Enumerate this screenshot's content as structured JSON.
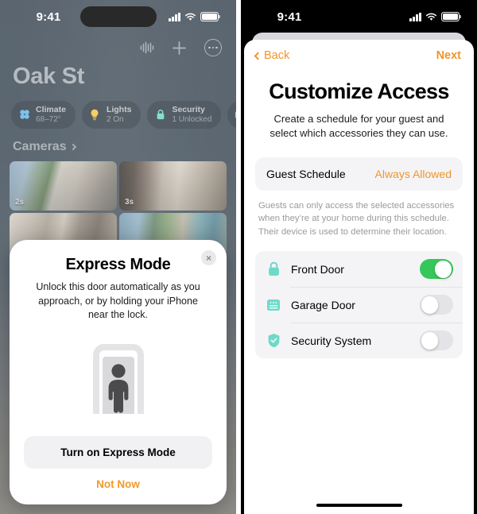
{
  "left_phone": {
    "status_bar": {
      "time": "9:41",
      "icons": [
        "cellular-signal-icon",
        "wifi-icon",
        "battery-icon"
      ]
    },
    "toolbar": {
      "items": [
        {
          "name": "siri-waveform-icon",
          "label": ""
        },
        {
          "name": "add-icon",
          "label": "+"
        },
        {
          "name": "more-icon",
          "label": ""
        }
      ]
    },
    "home_title": "Oak St",
    "chips": [
      {
        "icon": "climate-fan-icon",
        "title": "Climate",
        "subtitle": "68–72°"
      },
      {
        "icon": "lightbulb-icon",
        "title": "Lights",
        "subtitle": "2 On"
      },
      {
        "icon": "lock-icon",
        "title": "Security",
        "subtitle": "1 Unlocked"
      },
      {
        "icon": "speaker-icon",
        "title": "",
        "subtitle": ""
      }
    ],
    "cameras_header": "Cameras",
    "cameras": [
      {
        "badge": "2s"
      },
      {
        "badge": "3s"
      },
      {
        "badge": ""
      },
      {
        "badge": ""
      }
    ],
    "modal": {
      "close_label": "×",
      "title": "Express Mode",
      "body": "Unlock this door automatically as you approach, or by holding your iPhone near the lock.",
      "illustration": "person-in-doorway-icon",
      "primary_button": "Turn on Express Mode",
      "secondary_button": "Not Now"
    }
  },
  "right_phone": {
    "status_bar": {
      "time": "9:41",
      "icons": [
        "cellular-signal-icon",
        "wifi-icon",
        "battery-icon"
      ]
    },
    "nav": {
      "back_label": "Back",
      "next_label": "Next"
    },
    "title": "Customize Access",
    "subtitle": "Create a schedule for your guest and select which accessories they can use.",
    "schedule_row": {
      "label": "Guest Schedule",
      "value": "Always Allowed"
    },
    "note": "Guests can only access the selected accessories when they’re at your home during this schedule. Their device is used to determine their location.",
    "accessories": [
      {
        "icon": "lock-icon",
        "name": "Front Door",
        "enabled": true
      },
      {
        "icon": "garage-door-icon",
        "name": "Garage Door",
        "enabled": false
      },
      {
        "icon": "shield-check-icon",
        "name": "Security System",
        "enabled": false
      }
    ]
  },
  "colors": {
    "accent_orange": "#f0952a",
    "toggle_on_green": "#34c759",
    "accessory_icon_teal": "#6fd9c8",
    "home_background": "#3a4753"
  }
}
